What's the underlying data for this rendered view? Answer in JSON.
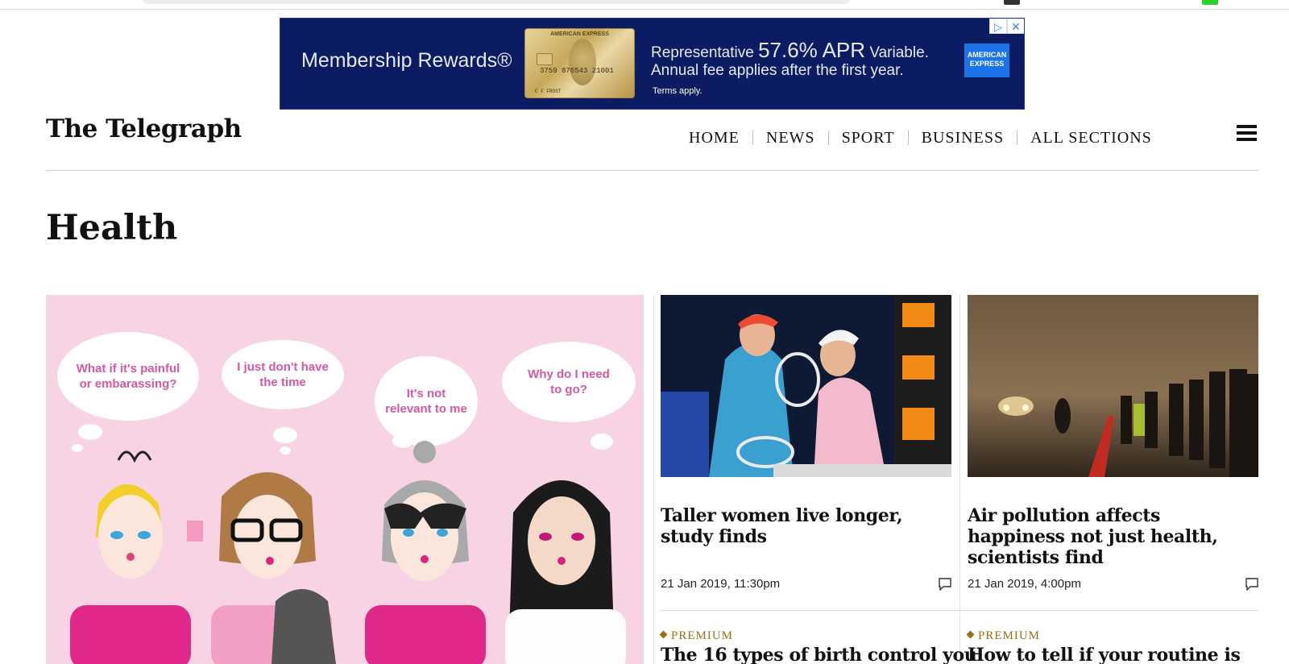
{
  "ad": {
    "brand": "Membership Rewards®",
    "card_top": "AMERICAN EXPRESS",
    "card_number": "3759 876543 21001",
    "card_name": "C F FROST",
    "line1_pre": "Representative",
    "line1_big": "57.6% APR",
    "line1_post": "Variable.",
    "line2": "Annual fee applies after the first year.",
    "terms": "Terms apply.",
    "logo": "AMERICAN EXPRESS",
    "adchoice_icon": "▷",
    "close_icon": "✕",
    "bg_color": "#0b1c63"
  },
  "header": {
    "logo": "The Telegraph",
    "nav": [
      "HOME",
      "NEWS",
      "SPORT",
      "BUSINESS",
      "ALL SECTIONS"
    ],
    "menu_icon": "hamburger-icon"
  },
  "section": {
    "title": "Health"
  },
  "hero": {
    "bubbles": [
      "What if it's painful or embarassing?",
      "I just don't have the time",
      "It's not relevant to me",
      "Why do I need to go?"
    ],
    "bg_color": "#f8d3e3",
    "text_color": "#d4599e"
  },
  "articles": [
    {
      "title": "Taller women live longer, study finds",
      "date": "21 Jan 2019, 11:30pm"
    },
    {
      "title": "Air pollution affects happiness not just health, scientists find",
      "date": "21 Jan 2019, 4:00pm"
    }
  ],
  "next_articles": [
    {
      "badge": "PREMIUM",
      "title": "The 16 types of birth control you"
    },
    {
      "badge": "PREMIUM",
      "title": "How to tell if your routine is"
    }
  ],
  "colors": {
    "premium": "#9a6e12",
    "text": "#111111"
  }
}
